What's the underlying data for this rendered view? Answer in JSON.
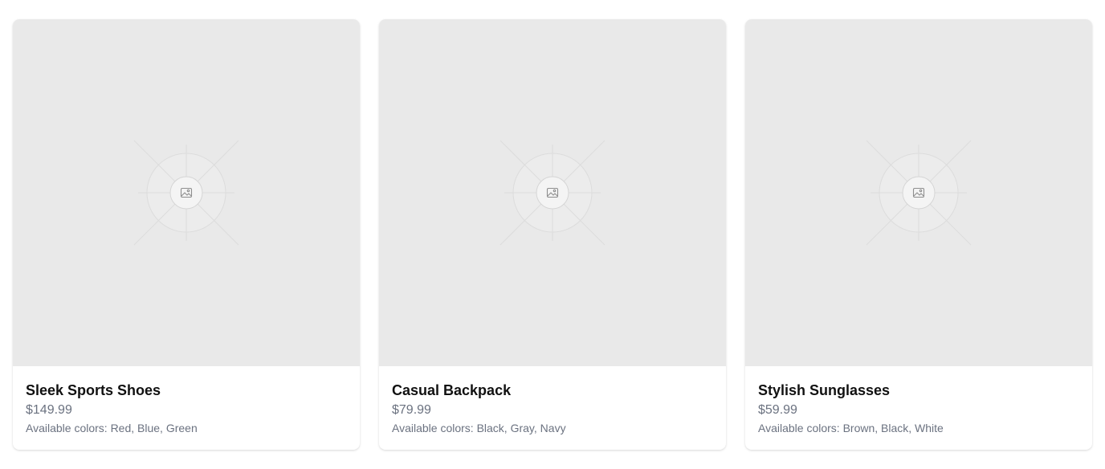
{
  "products": [
    {
      "name": "Sleek Sports Shoes",
      "price": "$149.99",
      "colors": "Available colors: Red, Blue, Green",
      "image_icon": "image-placeholder-icon"
    },
    {
      "name": "Casual Backpack",
      "price": "$79.99",
      "colors": "Available colors: Black, Gray, Navy",
      "image_icon": "image-placeholder-icon"
    },
    {
      "name": "Stylish Sunglasses",
      "price": "$59.99",
      "colors": "Available colors: Brown, Black, White",
      "image_icon": "image-placeholder-icon"
    }
  ],
  "theme": {
    "card_background": "#ffffff",
    "image_background": "#e9e9e9",
    "title_color": "#111111",
    "muted_text": "#6b7280"
  }
}
